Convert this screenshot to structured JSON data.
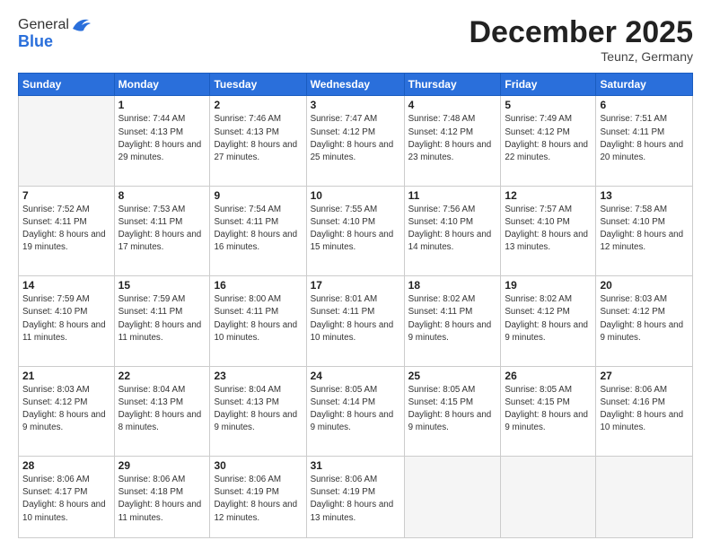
{
  "header": {
    "logo_general": "General",
    "logo_blue": "Blue",
    "month_title": "December 2025",
    "location": "Teunz, Germany"
  },
  "weekdays": [
    "Sunday",
    "Monday",
    "Tuesday",
    "Wednesday",
    "Thursday",
    "Friday",
    "Saturday"
  ],
  "weeks": [
    [
      {
        "day": "",
        "sunrise": "",
        "sunset": "",
        "daylight": ""
      },
      {
        "day": "1",
        "sunrise": "Sunrise: 7:44 AM",
        "sunset": "Sunset: 4:13 PM",
        "daylight": "Daylight: 8 hours and 29 minutes."
      },
      {
        "day": "2",
        "sunrise": "Sunrise: 7:46 AM",
        "sunset": "Sunset: 4:13 PM",
        "daylight": "Daylight: 8 hours and 27 minutes."
      },
      {
        "day": "3",
        "sunrise": "Sunrise: 7:47 AM",
        "sunset": "Sunset: 4:12 PM",
        "daylight": "Daylight: 8 hours and 25 minutes."
      },
      {
        "day": "4",
        "sunrise": "Sunrise: 7:48 AM",
        "sunset": "Sunset: 4:12 PM",
        "daylight": "Daylight: 8 hours and 23 minutes."
      },
      {
        "day": "5",
        "sunrise": "Sunrise: 7:49 AM",
        "sunset": "Sunset: 4:12 PM",
        "daylight": "Daylight: 8 hours and 22 minutes."
      },
      {
        "day": "6",
        "sunrise": "Sunrise: 7:51 AM",
        "sunset": "Sunset: 4:11 PM",
        "daylight": "Daylight: 8 hours and 20 minutes."
      }
    ],
    [
      {
        "day": "7",
        "sunrise": "Sunrise: 7:52 AM",
        "sunset": "Sunset: 4:11 PM",
        "daylight": "Daylight: 8 hours and 19 minutes."
      },
      {
        "day": "8",
        "sunrise": "Sunrise: 7:53 AM",
        "sunset": "Sunset: 4:11 PM",
        "daylight": "Daylight: 8 hours and 17 minutes."
      },
      {
        "day": "9",
        "sunrise": "Sunrise: 7:54 AM",
        "sunset": "Sunset: 4:11 PM",
        "daylight": "Daylight: 8 hours and 16 minutes."
      },
      {
        "day": "10",
        "sunrise": "Sunrise: 7:55 AM",
        "sunset": "Sunset: 4:10 PM",
        "daylight": "Daylight: 8 hours and 15 minutes."
      },
      {
        "day": "11",
        "sunrise": "Sunrise: 7:56 AM",
        "sunset": "Sunset: 4:10 PM",
        "daylight": "Daylight: 8 hours and 14 minutes."
      },
      {
        "day": "12",
        "sunrise": "Sunrise: 7:57 AM",
        "sunset": "Sunset: 4:10 PM",
        "daylight": "Daylight: 8 hours and 13 minutes."
      },
      {
        "day": "13",
        "sunrise": "Sunrise: 7:58 AM",
        "sunset": "Sunset: 4:10 PM",
        "daylight": "Daylight: 8 hours and 12 minutes."
      }
    ],
    [
      {
        "day": "14",
        "sunrise": "Sunrise: 7:59 AM",
        "sunset": "Sunset: 4:10 PM",
        "daylight": "Daylight: 8 hours and 11 minutes."
      },
      {
        "day": "15",
        "sunrise": "Sunrise: 7:59 AM",
        "sunset": "Sunset: 4:11 PM",
        "daylight": "Daylight: 8 hours and 11 minutes."
      },
      {
        "day": "16",
        "sunrise": "Sunrise: 8:00 AM",
        "sunset": "Sunset: 4:11 PM",
        "daylight": "Daylight: 8 hours and 10 minutes."
      },
      {
        "day": "17",
        "sunrise": "Sunrise: 8:01 AM",
        "sunset": "Sunset: 4:11 PM",
        "daylight": "Daylight: 8 hours and 10 minutes."
      },
      {
        "day": "18",
        "sunrise": "Sunrise: 8:02 AM",
        "sunset": "Sunset: 4:11 PM",
        "daylight": "Daylight: 8 hours and 9 minutes."
      },
      {
        "day": "19",
        "sunrise": "Sunrise: 8:02 AM",
        "sunset": "Sunset: 4:12 PM",
        "daylight": "Daylight: 8 hours and 9 minutes."
      },
      {
        "day": "20",
        "sunrise": "Sunrise: 8:03 AM",
        "sunset": "Sunset: 4:12 PM",
        "daylight": "Daylight: 8 hours and 9 minutes."
      }
    ],
    [
      {
        "day": "21",
        "sunrise": "Sunrise: 8:03 AM",
        "sunset": "Sunset: 4:12 PM",
        "daylight": "Daylight: 8 hours and 9 minutes."
      },
      {
        "day": "22",
        "sunrise": "Sunrise: 8:04 AM",
        "sunset": "Sunset: 4:13 PM",
        "daylight": "Daylight: 8 hours and 8 minutes."
      },
      {
        "day": "23",
        "sunrise": "Sunrise: 8:04 AM",
        "sunset": "Sunset: 4:13 PM",
        "daylight": "Daylight: 8 hours and 9 minutes."
      },
      {
        "day": "24",
        "sunrise": "Sunrise: 8:05 AM",
        "sunset": "Sunset: 4:14 PM",
        "daylight": "Daylight: 8 hours and 9 minutes."
      },
      {
        "day": "25",
        "sunrise": "Sunrise: 8:05 AM",
        "sunset": "Sunset: 4:15 PM",
        "daylight": "Daylight: 8 hours and 9 minutes."
      },
      {
        "day": "26",
        "sunrise": "Sunrise: 8:05 AM",
        "sunset": "Sunset: 4:15 PM",
        "daylight": "Daylight: 8 hours and 9 minutes."
      },
      {
        "day": "27",
        "sunrise": "Sunrise: 8:06 AM",
        "sunset": "Sunset: 4:16 PM",
        "daylight": "Daylight: 8 hours and 10 minutes."
      }
    ],
    [
      {
        "day": "28",
        "sunrise": "Sunrise: 8:06 AM",
        "sunset": "Sunset: 4:17 PM",
        "daylight": "Daylight: 8 hours and 10 minutes."
      },
      {
        "day": "29",
        "sunrise": "Sunrise: 8:06 AM",
        "sunset": "Sunset: 4:18 PM",
        "daylight": "Daylight: 8 hours and 11 minutes."
      },
      {
        "day": "30",
        "sunrise": "Sunrise: 8:06 AM",
        "sunset": "Sunset: 4:19 PM",
        "daylight": "Daylight: 8 hours and 12 minutes."
      },
      {
        "day": "31",
        "sunrise": "Sunrise: 8:06 AM",
        "sunset": "Sunset: 4:19 PM",
        "daylight": "Daylight: 8 hours and 13 minutes."
      },
      {
        "day": "",
        "sunrise": "",
        "sunset": "",
        "daylight": ""
      },
      {
        "day": "",
        "sunrise": "",
        "sunset": "",
        "daylight": ""
      },
      {
        "day": "",
        "sunrise": "",
        "sunset": "",
        "daylight": ""
      }
    ]
  ]
}
